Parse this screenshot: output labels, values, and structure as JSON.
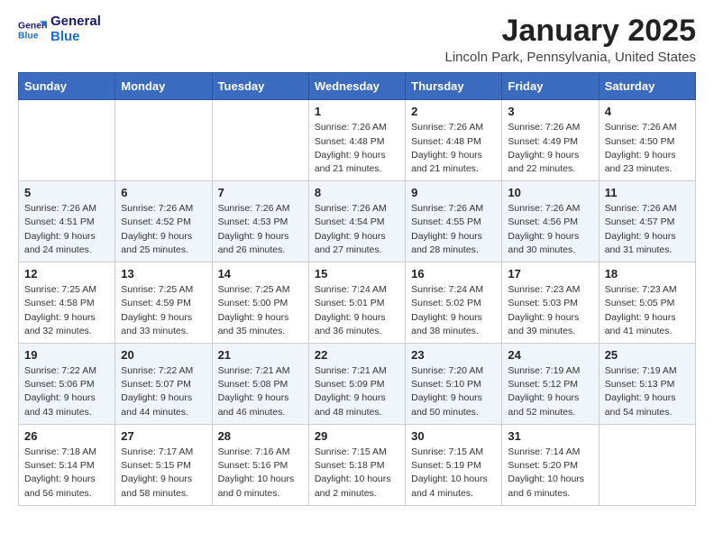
{
  "header": {
    "logo_general": "General",
    "logo_blue": "Blue",
    "month_title": "January 2025",
    "location": "Lincoln Park, Pennsylvania, United States"
  },
  "weekdays": [
    "Sunday",
    "Monday",
    "Tuesday",
    "Wednesday",
    "Thursday",
    "Friday",
    "Saturday"
  ],
  "weeks": [
    [
      {
        "day": "",
        "sunrise": "",
        "sunset": "",
        "daylight": ""
      },
      {
        "day": "",
        "sunrise": "",
        "sunset": "",
        "daylight": ""
      },
      {
        "day": "",
        "sunrise": "",
        "sunset": "",
        "daylight": ""
      },
      {
        "day": "1",
        "sunrise": "Sunrise: 7:26 AM",
        "sunset": "Sunset: 4:48 PM",
        "daylight": "Daylight: 9 hours and 21 minutes."
      },
      {
        "day": "2",
        "sunrise": "Sunrise: 7:26 AM",
        "sunset": "Sunset: 4:48 PM",
        "daylight": "Daylight: 9 hours and 21 minutes."
      },
      {
        "day": "3",
        "sunrise": "Sunrise: 7:26 AM",
        "sunset": "Sunset: 4:49 PM",
        "daylight": "Daylight: 9 hours and 22 minutes."
      },
      {
        "day": "4",
        "sunrise": "Sunrise: 7:26 AM",
        "sunset": "Sunset: 4:50 PM",
        "daylight": "Daylight: 9 hours and 23 minutes."
      }
    ],
    [
      {
        "day": "5",
        "sunrise": "Sunrise: 7:26 AM",
        "sunset": "Sunset: 4:51 PM",
        "daylight": "Daylight: 9 hours and 24 minutes."
      },
      {
        "day": "6",
        "sunrise": "Sunrise: 7:26 AM",
        "sunset": "Sunset: 4:52 PM",
        "daylight": "Daylight: 9 hours and 25 minutes."
      },
      {
        "day": "7",
        "sunrise": "Sunrise: 7:26 AM",
        "sunset": "Sunset: 4:53 PM",
        "daylight": "Daylight: 9 hours and 26 minutes."
      },
      {
        "day": "8",
        "sunrise": "Sunrise: 7:26 AM",
        "sunset": "Sunset: 4:54 PM",
        "daylight": "Daylight: 9 hours and 27 minutes."
      },
      {
        "day": "9",
        "sunrise": "Sunrise: 7:26 AM",
        "sunset": "Sunset: 4:55 PM",
        "daylight": "Daylight: 9 hours and 28 minutes."
      },
      {
        "day": "10",
        "sunrise": "Sunrise: 7:26 AM",
        "sunset": "Sunset: 4:56 PM",
        "daylight": "Daylight: 9 hours and 30 minutes."
      },
      {
        "day": "11",
        "sunrise": "Sunrise: 7:26 AM",
        "sunset": "Sunset: 4:57 PM",
        "daylight": "Daylight: 9 hours and 31 minutes."
      }
    ],
    [
      {
        "day": "12",
        "sunrise": "Sunrise: 7:25 AM",
        "sunset": "Sunset: 4:58 PM",
        "daylight": "Daylight: 9 hours and 32 minutes."
      },
      {
        "day": "13",
        "sunrise": "Sunrise: 7:25 AM",
        "sunset": "Sunset: 4:59 PM",
        "daylight": "Daylight: 9 hours and 33 minutes."
      },
      {
        "day": "14",
        "sunrise": "Sunrise: 7:25 AM",
        "sunset": "Sunset: 5:00 PM",
        "daylight": "Daylight: 9 hours and 35 minutes."
      },
      {
        "day": "15",
        "sunrise": "Sunrise: 7:24 AM",
        "sunset": "Sunset: 5:01 PM",
        "daylight": "Daylight: 9 hours and 36 minutes."
      },
      {
        "day": "16",
        "sunrise": "Sunrise: 7:24 AM",
        "sunset": "Sunset: 5:02 PM",
        "daylight": "Daylight: 9 hours and 38 minutes."
      },
      {
        "day": "17",
        "sunrise": "Sunrise: 7:23 AM",
        "sunset": "Sunset: 5:03 PM",
        "daylight": "Daylight: 9 hours and 39 minutes."
      },
      {
        "day": "18",
        "sunrise": "Sunrise: 7:23 AM",
        "sunset": "Sunset: 5:05 PM",
        "daylight": "Daylight: 9 hours and 41 minutes."
      }
    ],
    [
      {
        "day": "19",
        "sunrise": "Sunrise: 7:22 AM",
        "sunset": "Sunset: 5:06 PM",
        "daylight": "Daylight: 9 hours and 43 minutes."
      },
      {
        "day": "20",
        "sunrise": "Sunrise: 7:22 AM",
        "sunset": "Sunset: 5:07 PM",
        "daylight": "Daylight: 9 hours and 44 minutes."
      },
      {
        "day": "21",
        "sunrise": "Sunrise: 7:21 AM",
        "sunset": "Sunset: 5:08 PM",
        "daylight": "Daylight: 9 hours and 46 minutes."
      },
      {
        "day": "22",
        "sunrise": "Sunrise: 7:21 AM",
        "sunset": "Sunset: 5:09 PM",
        "daylight": "Daylight: 9 hours and 48 minutes."
      },
      {
        "day": "23",
        "sunrise": "Sunrise: 7:20 AM",
        "sunset": "Sunset: 5:10 PM",
        "daylight": "Daylight: 9 hours and 50 minutes."
      },
      {
        "day": "24",
        "sunrise": "Sunrise: 7:19 AM",
        "sunset": "Sunset: 5:12 PM",
        "daylight": "Daylight: 9 hours and 52 minutes."
      },
      {
        "day": "25",
        "sunrise": "Sunrise: 7:19 AM",
        "sunset": "Sunset: 5:13 PM",
        "daylight": "Daylight: 9 hours and 54 minutes."
      }
    ],
    [
      {
        "day": "26",
        "sunrise": "Sunrise: 7:18 AM",
        "sunset": "Sunset: 5:14 PM",
        "daylight": "Daylight: 9 hours and 56 minutes."
      },
      {
        "day": "27",
        "sunrise": "Sunrise: 7:17 AM",
        "sunset": "Sunset: 5:15 PM",
        "daylight": "Daylight: 9 hours and 58 minutes."
      },
      {
        "day": "28",
        "sunrise": "Sunrise: 7:16 AM",
        "sunset": "Sunset: 5:16 PM",
        "daylight": "Daylight: 10 hours and 0 minutes."
      },
      {
        "day": "29",
        "sunrise": "Sunrise: 7:15 AM",
        "sunset": "Sunset: 5:18 PM",
        "daylight": "Daylight: 10 hours and 2 minutes."
      },
      {
        "day": "30",
        "sunrise": "Sunrise: 7:15 AM",
        "sunset": "Sunset: 5:19 PM",
        "daylight": "Daylight: 10 hours and 4 minutes."
      },
      {
        "day": "31",
        "sunrise": "Sunrise: 7:14 AM",
        "sunset": "Sunset: 5:20 PM",
        "daylight": "Daylight: 10 hours and 6 minutes."
      },
      {
        "day": "",
        "sunrise": "",
        "sunset": "",
        "daylight": ""
      }
    ]
  ]
}
